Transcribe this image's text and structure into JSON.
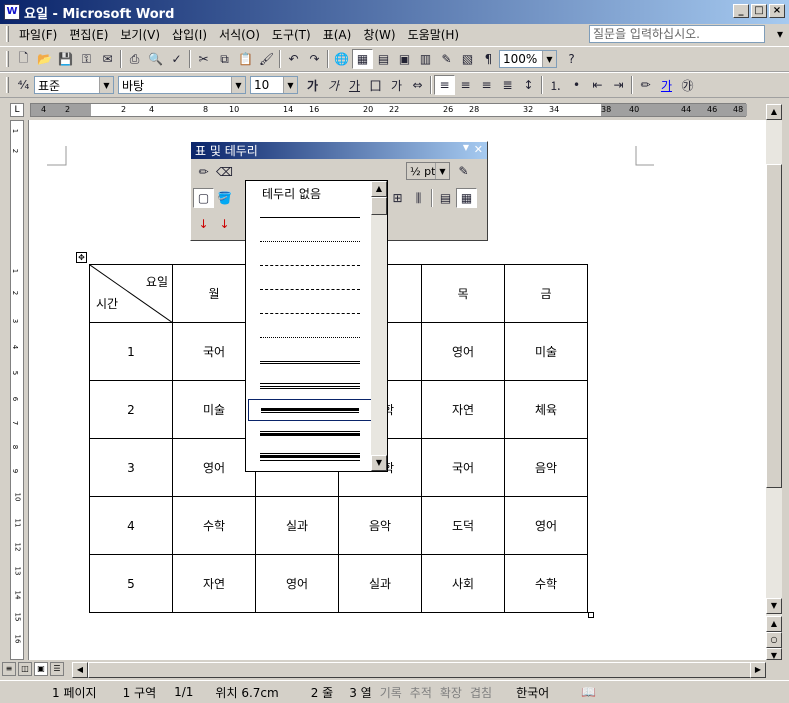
{
  "window": {
    "title": "요일 - Microsoft Word",
    "icon": "W"
  },
  "menu": [
    "파일(F)",
    "편집(E)",
    "보기(V)",
    "삽입(I)",
    "서식(O)",
    "도구(T)",
    "표(A)",
    "창(W)",
    "도움말(H)"
  ],
  "help_placeholder": "질문을 입력하십시오.",
  "toolbar1": {
    "zoom": "100%"
  },
  "toolbar2": {
    "style": "표준",
    "font": "바탕",
    "size": "10"
  },
  "hruler_ticks": [
    "4",
    "2",
    "2",
    "4",
    "8",
    "10",
    "14",
    "16",
    "20",
    "22",
    "26",
    "28",
    "32",
    "34",
    "38",
    "40",
    "44",
    "46",
    "48"
  ],
  "vruler_ticks": [
    "1",
    "2",
    "1",
    "2",
    "3",
    "4",
    "5",
    "6",
    "7",
    "8",
    "9",
    "10",
    "11",
    "12",
    "13",
    "14",
    "15",
    "16"
  ],
  "palette": {
    "title": "표 및 테두리",
    "weight": "½ pt"
  },
  "line_styles": {
    "none": "테두리 없음"
  },
  "table": {
    "header_corner": {
      "top": "요일",
      "bottom": "시간"
    },
    "header": [
      "월",
      "",
      "",
      "목",
      "금"
    ],
    "rows": [
      [
        "1",
        "국어",
        "",
        "",
        "영어",
        "미술"
      ],
      [
        "2",
        "미술",
        "",
        "",
        "자연",
        "체육"
      ],
      [
        "3",
        "영어",
        "",
        "",
        "국어",
        "음악"
      ],
      [
        "4",
        "수학",
        "실과",
        "음악",
        "도덕",
        "영어"
      ],
      [
        "5",
        "자연",
        "영어",
        "실과",
        "사회",
        "수학"
      ]
    ],
    "partials": {
      "r1c4": "|",
      "r2c4": "학",
      "r3c4": "학"
    }
  },
  "status": {
    "page": "1 페이지",
    "section": "1 구역",
    "pages": "1/1",
    "pos": "위치 6.7cm",
    "line": "2 줄",
    "col": "3 열",
    "rec": "기록",
    "trk": "추적",
    "ext": "확장",
    "ovr": "겹침",
    "lang": "한국어"
  }
}
